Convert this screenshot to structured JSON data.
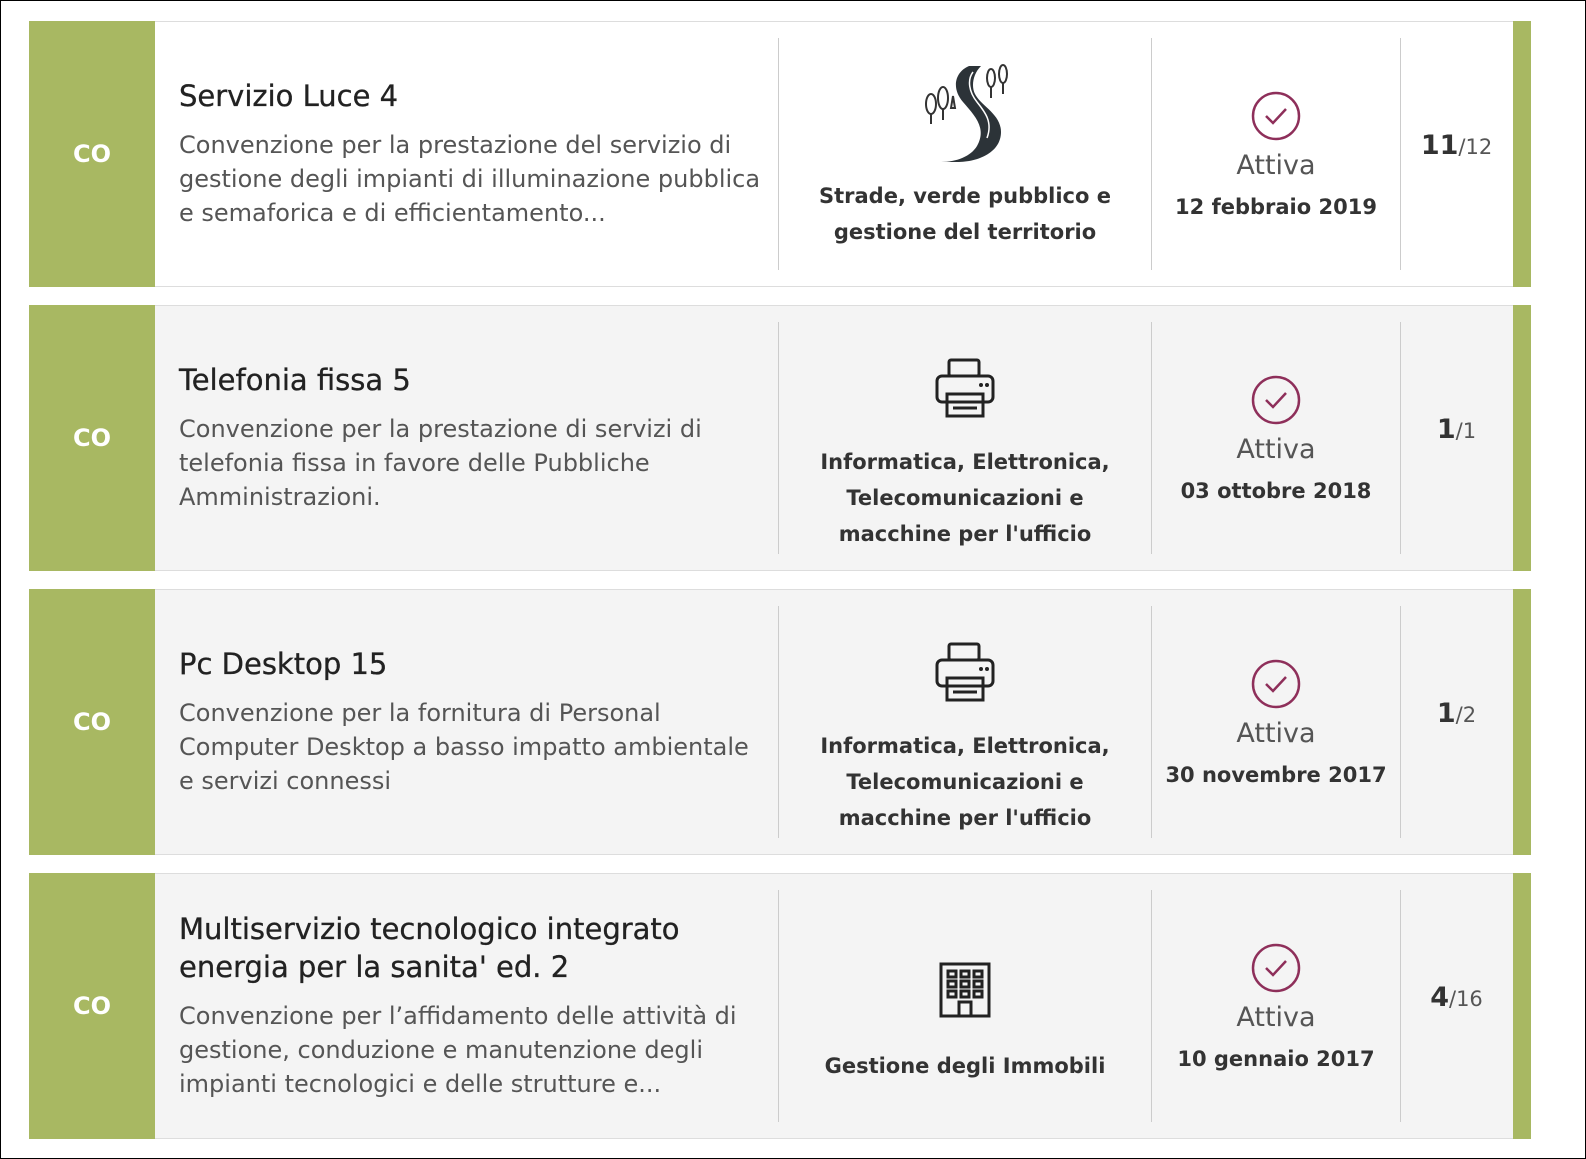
{
  "items": [
    {
      "badge": "CO",
      "title": "Servizio Luce 4",
      "description": "Convenzione per la prestazione del servizio di gestione degli impianti di illuminazione pubblica e semaforica e di efficientamento...",
      "category": "Strade, verde pubblico e gestione del territorio",
      "category_icon": "road-icon",
      "status": "Attiva",
      "date": "12 febbraio 2019",
      "count": "11",
      "total": "/12"
    },
    {
      "badge": "CO",
      "title": "Telefonia fissa 5",
      "description": "Convenzione per la prestazione di servizi di telefonia fissa in favore delle Pubbliche Amministrazioni.",
      "category": "Informatica, Elettronica, Telecomunicazioni e macchine per l'ufficio",
      "category_icon": "printer-icon",
      "status": "Attiva",
      "date": "03 ottobre 2018",
      "count": "1",
      "total": "/1"
    },
    {
      "badge": "CO",
      "title": "Pc Desktop 15",
      "description": "Convenzione per la fornitura di Personal Computer Desktop a basso impatto ambientale e servizi connessi",
      "category": "Informatica, Elettronica, Telecomunicazioni e macchine per l'ufficio",
      "category_icon": "printer-icon",
      "status": "Attiva",
      "date": "30 novembre 2017",
      "count": "1",
      "total": "/2"
    },
    {
      "badge": "CO",
      "title": "Multiservizio tecnologico integrato energia per la sanita' ed. 2",
      "description": "Convenzione per l’affidamento delle attività di gestione, conduzione e manutenzione degli impianti tecnologici e delle strutture e...",
      "category": "Gestione degli Immobili",
      "category_icon": "building-icon",
      "status": "Attiva",
      "date": "10 gennaio 2017",
      "count": "4",
      "total": "/16"
    }
  ],
  "colors": {
    "accent_green": "#a8b862",
    "status_icon": "#8e2f5a"
  }
}
